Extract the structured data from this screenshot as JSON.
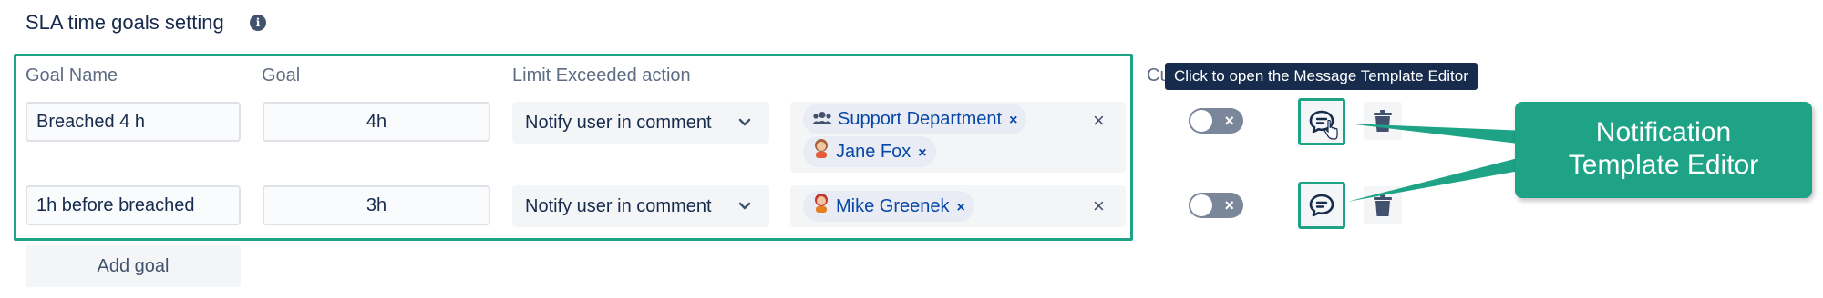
{
  "section": {
    "title": "SLA time goals setting",
    "info_icon": "info-icon"
  },
  "columns": {
    "goal_name": "Goal Name",
    "goal": "Goal",
    "limit_action": "Limit Exceeded action",
    "cut_label": "Cu"
  },
  "rows": [
    {
      "goal_name": "Breached 4 h",
      "goal": "4h",
      "action": "Notify user in comment",
      "recipients": [
        {
          "label": "Support Department",
          "icon": "group-icon"
        },
        {
          "label": "Jane Fox",
          "icon": "avatar-icon"
        }
      ],
      "clear": "×",
      "toggle_mark": "×"
    },
    {
      "goal_name": "1h before breached",
      "goal": "3h",
      "action": "Notify user in comment",
      "recipients": [
        {
          "label": "Mike Greenek",
          "icon": "avatar-icon"
        }
      ],
      "clear": "×",
      "toggle_mark": "×"
    }
  ],
  "chip_remove": "×",
  "tooltip": "Click to open the Message Template Editor",
  "callout": {
    "line1": "Notification",
    "line2": "Template Editor"
  },
  "add_goal": "Add goal",
  "colors": {
    "accent": "#1ea387",
    "tooltip_bg": "#172b4d",
    "chip_text": "#0747a6"
  }
}
